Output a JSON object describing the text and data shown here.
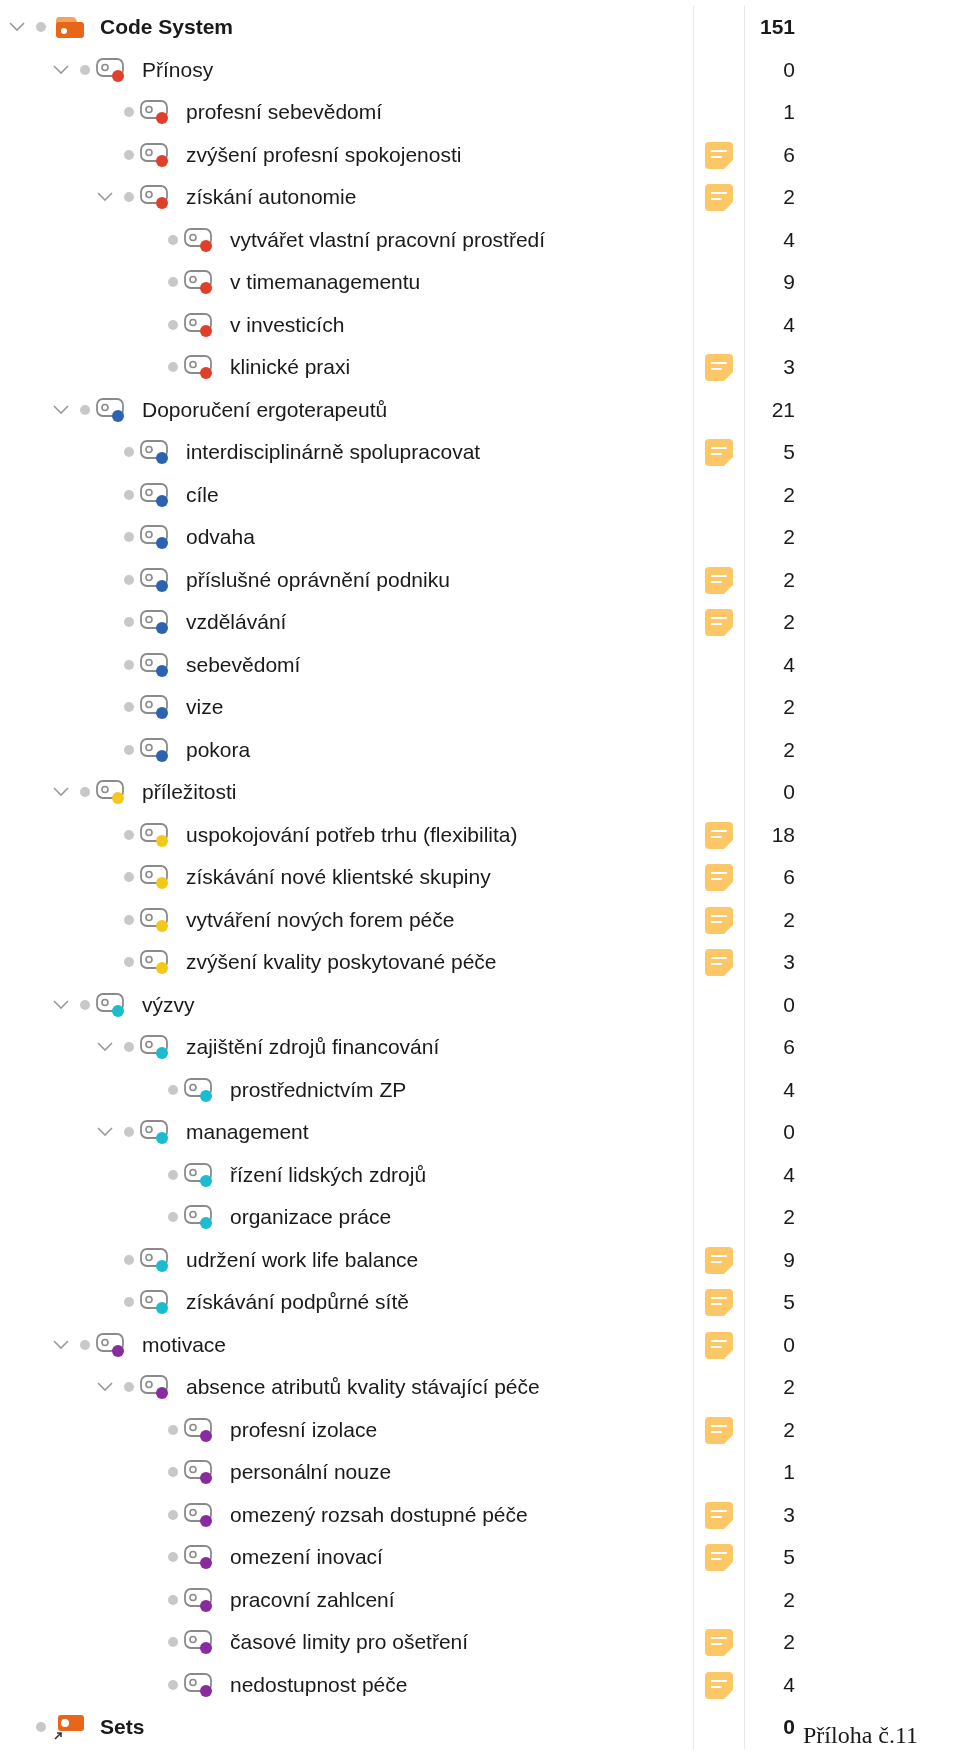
{
  "root": {
    "label": "Code System",
    "count": "151",
    "expanded": true,
    "children": [
      {
        "label": "Přínosy",
        "count": "0",
        "color": "#e0402a",
        "memo": false,
        "expanded": true,
        "children": [
          {
            "label": "profesní sebevědomí",
            "count": "1",
            "color": "#e0402a",
            "memo": false
          },
          {
            "label": "zvýšení profesní spokojenosti",
            "count": "6",
            "color": "#e0402a",
            "memo": true
          },
          {
            "label": "získání autonomie",
            "count": "2",
            "color": "#e0402a",
            "memo": true,
            "expanded": true,
            "children": [
              {
                "label": "vytvářet vlastní pracovní prostředí",
                "count": "4",
                "color": "#e0402a",
                "memo": false
              },
              {
                "label": "v timemanagementu",
                "count": "9",
                "color": "#e0402a",
                "memo": false
              },
              {
                "label": "v investicích",
                "count": "4",
                "color": "#e0402a",
                "memo": false
              },
              {
                "label": "klinické praxi",
                "count": "3",
                "color": "#e0402a",
                "memo": true
              }
            ]
          }
        ]
      },
      {
        "label": "Doporučení ergoterapeutů",
        "count": "21",
        "color": "#2b63b0",
        "memo": false,
        "expanded": true,
        "children": [
          {
            "label": "interdisciplinárně spolupracovat",
            "count": "5",
            "color": "#2b63b0",
            "memo": true
          },
          {
            "label": "cíle",
            "count": "2",
            "color": "#2b63b0",
            "memo": false
          },
          {
            "label": "odvaha",
            "count": "2",
            "color": "#2b63b0",
            "memo": false
          },
          {
            "label": "příslušné oprávnění podniku",
            "count": "2",
            "color": "#2b63b0",
            "memo": true
          },
          {
            "label": "vzdělávání",
            "count": "2",
            "color": "#2b63b0",
            "memo": true
          },
          {
            "label": "sebevědomí",
            "count": "4",
            "color": "#2b63b0",
            "memo": false
          },
          {
            "label": "vize",
            "count": "2",
            "color": "#2b63b0",
            "memo": false
          },
          {
            "label": "pokora",
            "count": "2",
            "color": "#2b63b0",
            "memo": false
          }
        ]
      },
      {
        "label": "příležitosti",
        "count": "0",
        "color": "#f2c81a",
        "memo": false,
        "expanded": true,
        "children": [
          {
            "label": "uspokojování potřeb trhu (flexibilita)",
            "count": "18",
            "color": "#f2c81a",
            "memo": true
          },
          {
            "label": "získávání nové klientské skupiny",
            "count": "6",
            "color": "#f2c81a",
            "memo": true
          },
          {
            "label": "vytváření nových forem péče",
            "count": "2",
            "color": "#f2c81a",
            "memo": true
          },
          {
            "label": "zvýšení kvality poskytované péče",
            "count": "3",
            "color": "#f2c81a",
            "memo": true
          }
        ]
      },
      {
        "label": "výzvy",
        "count": "0",
        "color": "#1bbcd0",
        "memo": false,
        "expanded": true,
        "children": [
          {
            "label": "zajištění zdrojů financování",
            "count": "6",
            "color": "#1bbcd0",
            "memo": false,
            "expanded": true,
            "children": [
              {
                "label": "prostřednictvím ZP",
                "count": "4",
                "color": "#1bbcd0",
                "memo": false
              }
            ]
          },
          {
            "label": "management",
            "count": "0",
            "color": "#1bbcd0",
            "memo": false,
            "expanded": true,
            "children": [
              {
                "label": "řízení lidských zdrojů",
                "count": "4",
                "color": "#1bbcd0",
                "memo": false
              },
              {
                "label": "organizace práce",
                "count": "2",
                "color": "#1bbcd0",
                "memo": false
              }
            ]
          },
          {
            "label": "udržení work life balance",
            "count": "9",
            "color": "#1bbcd0",
            "memo": true
          },
          {
            "label": "získávání podpůrné sítě",
            "count": "5",
            "color": "#1bbcd0",
            "memo": true
          }
        ]
      },
      {
        "label": "motivace",
        "count": "0",
        "color": "#8a2aa0",
        "memo": true,
        "expanded": true,
        "children": [
          {
            "label": "absence atributů kvality stávající péče",
            "count": "2",
            "color": "#8a2aa0",
            "memo": false,
            "expanded": true,
            "children": [
              {
                "label": "profesní izolace",
                "count": "2",
                "color": "#8a2aa0",
                "memo": true
              },
              {
                "label": "personální nouze",
                "count": "1",
                "color": "#8a2aa0",
                "memo": false
              },
              {
                "label": "omezený rozsah dostupné péče",
                "count": "3",
                "color": "#8a2aa0",
                "memo": true
              },
              {
                "label": "omezení inovací",
                "count": "5",
                "color": "#8a2aa0",
                "memo": true
              },
              {
                "label": "pracovní zahlcení",
                "count": "2",
                "color": "#8a2aa0",
                "memo": false
              },
              {
                "label": "časové limity pro ošetření",
                "count": "2",
                "color": "#8a2aa0",
                "memo": true
              },
              {
                "label": "nedostupnost péče",
                "count": "4",
                "color": "#8a2aa0",
                "memo": true
              }
            ]
          }
        ]
      }
    ]
  },
  "sets": {
    "label": "Sets",
    "count": "0"
  },
  "caption": "Příloha č.11"
}
